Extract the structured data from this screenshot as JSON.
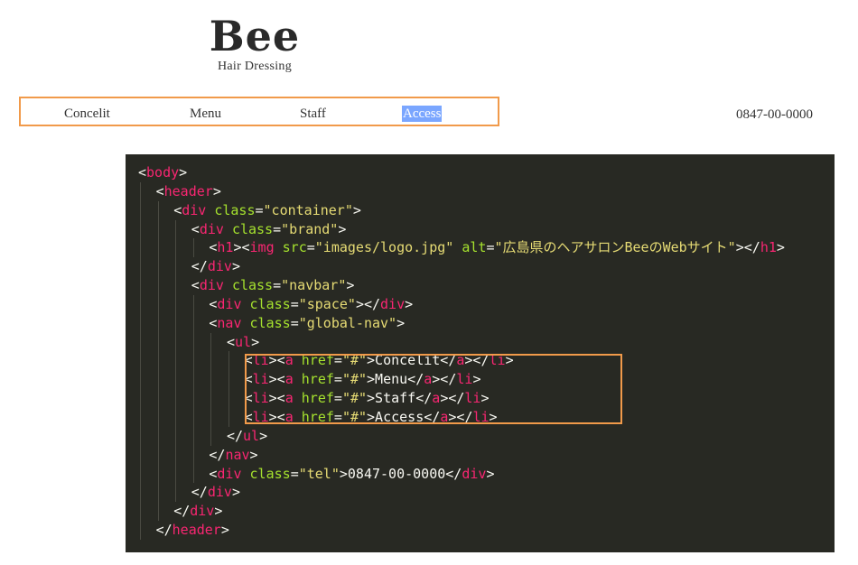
{
  "brand": {
    "logo_text": "Bee",
    "logo_subtitle": "Hair Dressing"
  },
  "nav": {
    "items": [
      {
        "label": "Concelit",
        "active": false
      },
      {
        "label": "Menu",
        "active": false
      },
      {
        "label": "Staff",
        "active": false
      },
      {
        "label": "Access",
        "active": true
      }
    ]
  },
  "tel": "0847-00-0000",
  "highlight_color": "#f19a4a",
  "active_color": "#7aa6ff",
  "editor_bg": "#282923",
  "code": {
    "lines": [
      {
        "indent": 0,
        "tokens": [
          [
            "p",
            "<"
          ],
          [
            "t",
            "body"
          ],
          [
            "p",
            ">"
          ]
        ]
      },
      {
        "indent": 1,
        "tokens": [
          [
            "p",
            "<"
          ],
          [
            "t",
            "header"
          ],
          [
            "p",
            ">"
          ]
        ]
      },
      {
        "indent": 2,
        "tokens": [
          [
            "p",
            "<"
          ],
          [
            "t",
            "div"
          ],
          [
            "p",
            " "
          ],
          [
            "a",
            "class"
          ],
          [
            "p",
            "="
          ],
          [
            "s",
            "\"container\""
          ],
          [
            "p",
            ">"
          ]
        ]
      },
      {
        "indent": 3,
        "tokens": [
          [
            "p",
            "<"
          ],
          [
            "t",
            "div"
          ],
          [
            "p",
            " "
          ],
          [
            "a",
            "class"
          ],
          [
            "p",
            "="
          ],
          [
            "s",
            "\"brand\""
          ],
          [
            "p",
            ">"
          ]
        ]
      },
      {
        "indent": 4,
        "tokens": [
          [
            "p",
            "<"
          ],
          [
            "t",
            "h1"
          ],
          [
            "p",
            "><"
          ],
          [
            "t",
            "img"
          ],
          [
            "p",
            " "
          ],
          [
            "a",
            "src"
          ],
          [
            "p",
            "="
          ],
          [
            "s",
            "\"images/logo.jpg\""
          ],
          [
            "p",
            " "
          ],
          [
            "a",
            "alt"
          ],
          [
            "p",
            "="
          ],
          [
            "s",
            "\"広島県のヘアサロンBeeのWebサイト\""
          ],
          [
            "p",
            "></"
          ],
          [
            "t",
            "h1"
          ],
          [
            "p",
            ">"
          ]
        ]
      },
      {
        "indent": 3,
        "tokens": [
          [
            "p",
            "</"
          ],
          [
            "t",
            "div"
          ],
          [
            "p",
            ">"
          ]
        ]
      },
      {
        "indent": 3,
        "tokens": [
          [
            "p",
            "<"
          ],
          [
            "t",
            "div"
          ],
          [
            "p",
            " "
          ],
          [
            "a",
            "class"
          ],
          [
            "p",
            "="
          ],
          [
            "s",
            "\"navbar\""
          ],
          [
            "p",
            ">"
          ]
        ]
      },
      {
        "indent": 4,
        "tokens": [
          [
            "p",
            "<"
          ],
          [
            "t",
            "div"
          ],
          [
            "p",
            " "
          ],
          [
            "a",
            "class"
          ],
          [
            "p",
            "="
          ],
          [
            "s",
            "\"space\""
          ],
          [
            "p",
            "></"
          ],
          [
            "t",
            "div"
          ],
          [
            "p",
            ">"
          ]
        ]
      },
      {
        "indent": 4,
        "tokens": [
          [
            "p",
            "<"
          ],
          [
            "t",
            "nav"
          ],
          [
            "p",
            " "
          ],
          [
            "a",
            "class"
          ],
          [
            "p",
            "="
          ],
          [
            "s",
            "\"global-nav\""
          ],
          [
            "p",
            ">"
          ]
        ]
      },
      {
        "indent": 5,
        "tokens": [
          [
            "p",
            "<"
          ],
          [
            "t",
            "ul"
          ],
          [
            "p",
            ">"
          ]
        ]
      },
      {
        "indent": 6,
        "tokens": [
          [
            "p",
            "<"
          ],
          [
            "t",
            "li"
          ],
          [
            "p",
            "><"
          ],
          [
            "t",
            "a"
          ],
          [
            "p",
            " "
          ],
          [
            "a",
            "href"
          ],
          [
            "p",
            "="
          ],
          [
            "s",
            "\"#\""
          ],
          [
            "p",
            ">Concelit</"
          ],
          [
            "t",
            "a"
          ],
          [
            "p",
            "></"
          ],
          [
            "t",
            "li"
          ],
          [
            "p",
            ">"
          ]
        ]
      },
      {
        "indent": 6,
        "tokens": [
          [
            "p",
            "<"
          ],
          [
            "t",
            "li"
          ],
          [
            "p",
            "><"
          ],
          [
            "t",
            "a"
          ],
          [
            "p",
            " "
          ],
          [
            "a",
            "href"
          ],
          [
            "p",
            "="
          ],
          [
            "s",
            "\"#\""
          ],
          [
            "p",
            ">Menu</"
          ],
          [
            "t",
            "a"
          ],
          [
            "p",
            "></"
          ],
          [
            "t",
            "li"
          ],
          [
            "p",
            ">"
          ]
        ]
      },
      {
        "indent": 6,
        "tokens": [
          [
            "p",
            "<"
          ],
          [
            "t",
            "li"
          ],
          [
            "p",
            "><"
          ],
          [
            "t",
            "a"
          ],
          [
            "p",
            " "
          ],
          [
            "a",
            "href"
          ],
          [
            "p",
            "="
          ],
          [
            "s",
            "\"#\""
          ],
          [
            "p",
            ">Staff</"
          ],
          [
            "t",
            "a"
          ],
          [
            "p",
            "></"
          ],
          [
            "t",
            "li"
          ],
          [
            "p",
            ">"
          ]
        ]
      },
      {
        "indent": 6,
        "tokens": [
          [
            "p",
            "<"
          ],
          [
            "t",
            "li"
          ],
          [
            "p",
            "><"
          ],
          [
            "t",
            "a"
          ],
          [
            "p",
            " "
          ],
          [
            "a",
            "href"
          ],
          [
            "p",
            "="
          ],
          [
            "s",
            "\"#\""
          ],
          [
            "p",
            ">Access</"
          ],
          [
            "t",
            "a"
          ],
          [
            "p",
            "></"
          ],
          [
            "t",
            "li"
          ],
          [
            "p",
            ">"
          ]
        ]
      },
      {
        "indent": 5,
        "tokens": [
          [
            "p",
            "</"
          ],
          [
            "t",
            "ul"
          ],
          [
            "p",
            ">"
          ]
        ]
      },
      {
        "indent": 4,
        "tokens": [
          [
            "p",
            "</"
          ],
          [
            "t",
            "nav"
          ],
          [
            "p",
            ">"
          ]
        ]
      },
      {
        "indent": 4,
        "tokens": [
          [
            "p",
            "<"
          ],
          [
            "t",
            "div"
          ],
          [
            "p",
            " "
          ],
          [
            "a",
            "class"
          ],
          [
            "p",
            "="
          ],
          [
            "s",
            "\"tel\""
          ],
          [
            "p",
            ">0847-00-0000</"
          ],
          [
            "t",
            "div"
          ],
          [
            "p",
            ">"
          ]
        ]
      },
      {
        "indent": 3,
        "tokens": [
          [
            "p",
            "</"
          ],
          [
            "t",
            "div"
          ],
          [
            "p",
            ">"
          ]
        ]
      },
      {
        "indent": 2,
        "tokens": [
          [
            "p",
            "</"
          ],
          [
            "t",
            "div"
          ],
          [
            "p",
            ">"
          ]
        ]
      },
      {
        "indent": 1,
        "tokens": [
          [
            "p",
            "</"
          ],
          [
            "t",
            "header"
          ],
          [
            "p",
            ">"
          ]
        ]
      }
    ]
  }
}
